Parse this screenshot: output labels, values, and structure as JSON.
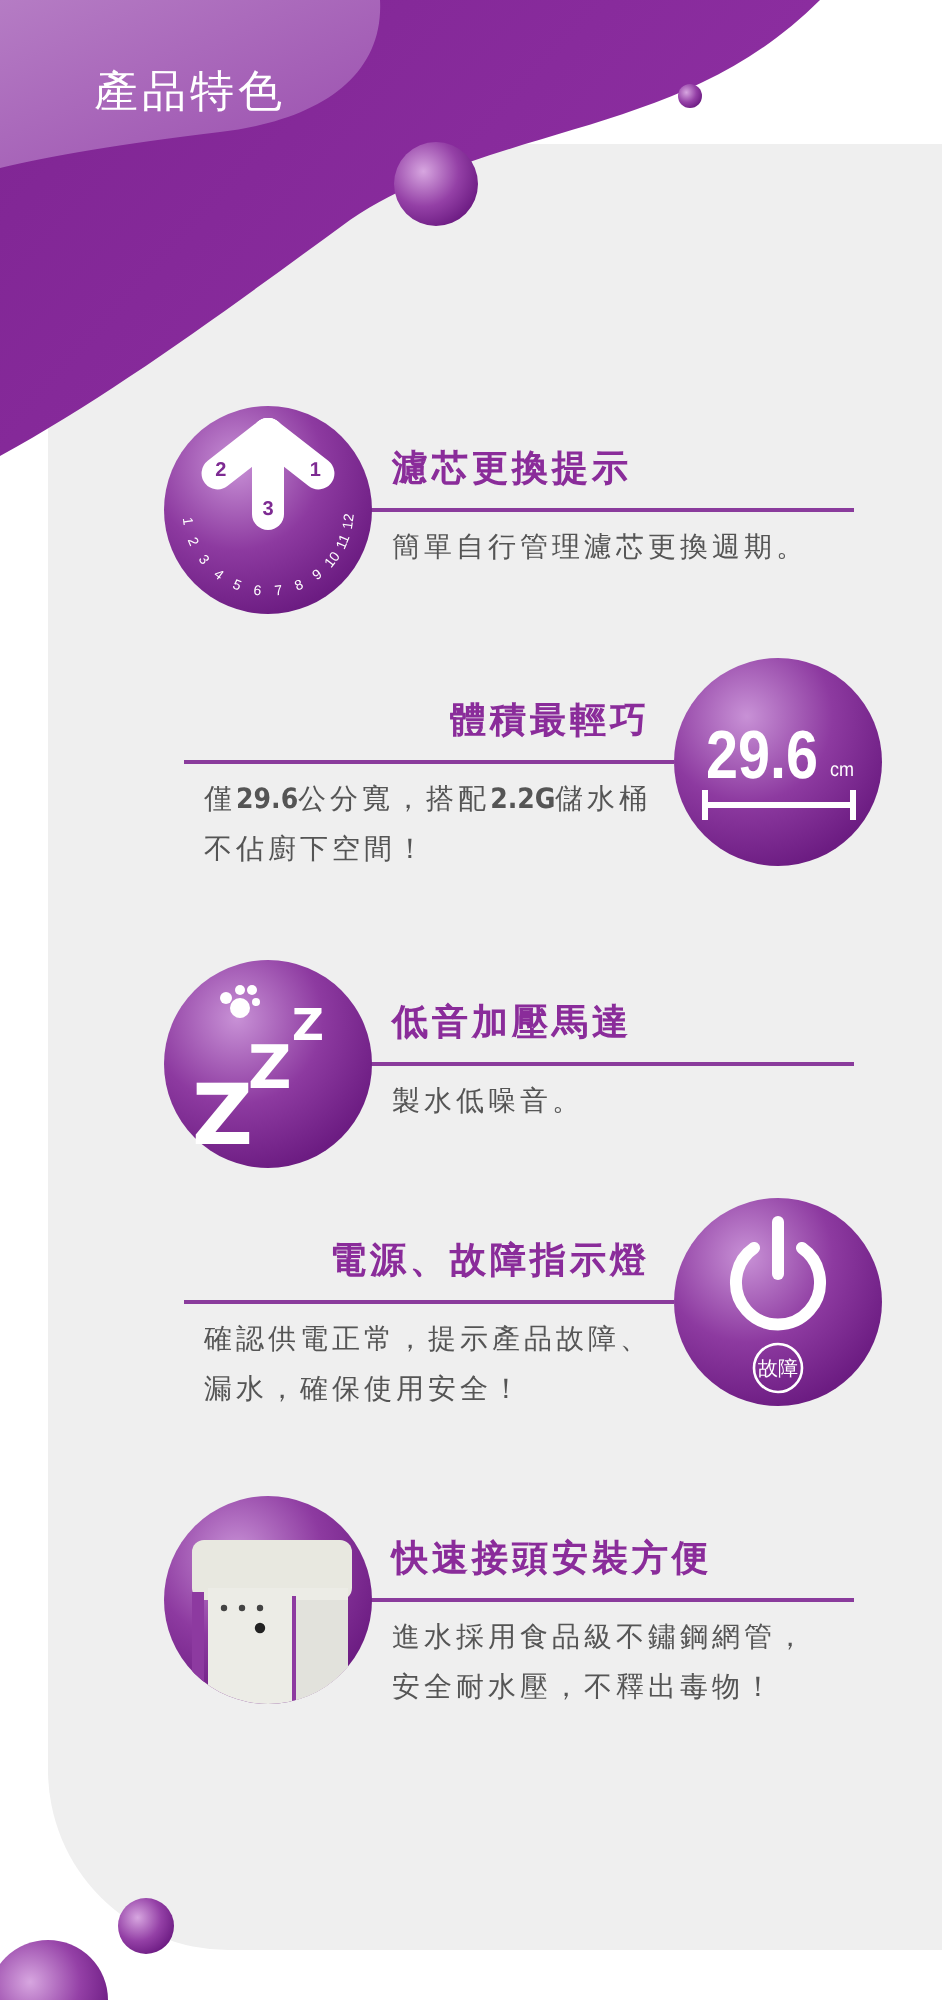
{
  "header": {
    "title": "產品特色"
  },
  "features": [
    {
      "kind": "clock",
      "title": "濾芯更換提示",
      "description": [
        "簡單自行管理濾芯更換週期。"
      ],
      "hands": [
        "1",
        "2",
        "3"
      ],
      "dial": [
        "1",
        "2",
        "3",
        "4",
        "5",
        "6",
        "7",
        "8",
        "9",
        "10",
        "11",
        "12"
      ]
    },
    {
      "kind": "size",
      "title": "體積最輕巧",
      "description": [
        "僅**29.6**公分寬，搭配**2.2G**儲水桶",
        "不佔廚下空間！"
      ],
      "value": "29.6",
      "unit": "cm"
    },
    {
      "kind": "quiet",
      "title": "低音加壓馬達",
      "description": [
        "製水低噪音。"
      ],
      "letters": [
        "Z",
        "Z",
        "Z"
      ]
    },
    {
      "kind": "power",
      "title": "電源、故障指示燈",
      "description": [
        "確認供電正常，提示產品故障、",
        "漏水，確保使用安全！"
      ],
      "badge": "故障"
    },
    {
      "kind": "picture",
      "title": "快速接頭安裝方便",
      "description": [
        "進水採用食品級不鏽鋼網管，",
        "安全耐水壓，不釋出毒物！"
      ]
    }
  ]
}
